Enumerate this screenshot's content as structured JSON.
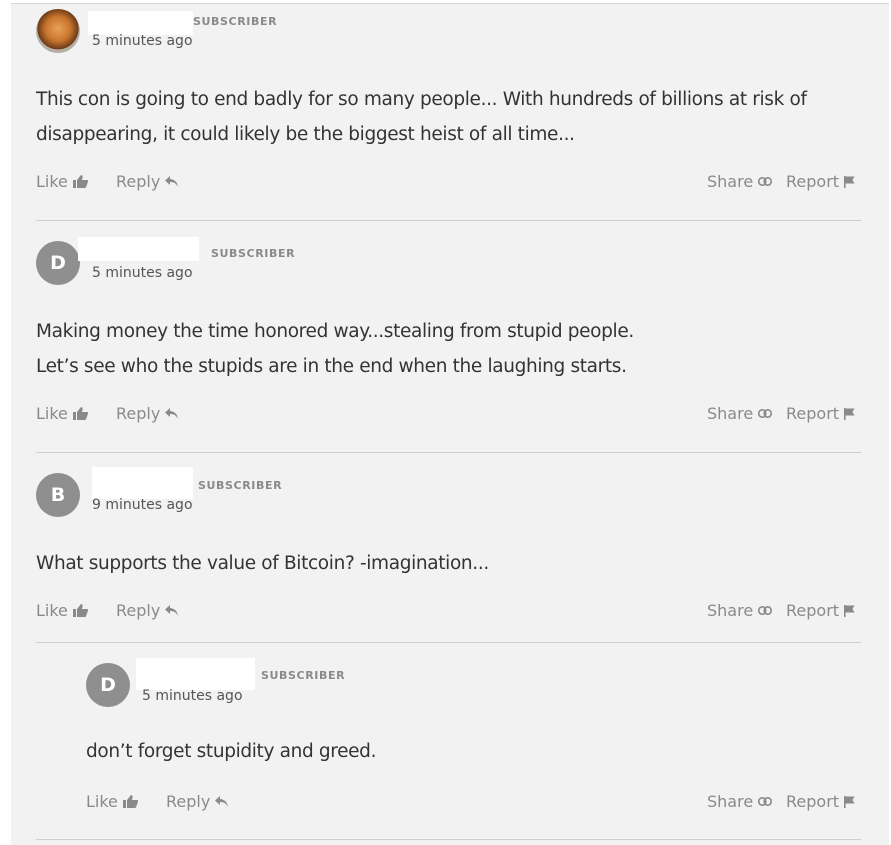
{
  "badge_label": "SUBSCRIBER",
  "actions": {
    "like": "Like",
    "reply": "Reply",
    "share": "Share",
    "report": "Report"
  },
  "comments": [
    {
      "avatar_letter": "",
      "avatar_kind": "tiger photo",
      "time": "5 minutes ago",
      "lines": [
        "This con is going to end badly for so many people... With hundreds of billions at risk of",
        "disappearing, it could likely be the biggest heist of all time..."
      ]
    },
    {
      "avatar_letter": "D",
      "time": "5 minutes ago",
      "lines": [
        "Making money the time honored way...stealing from stupid people.",
        "Let’s see who the stupids are in the end when the laughing starts."
      ]
    },
    {
      "avatar_letter": "B",
      "time": "9 minutes ago",
      "lines": [
        "What supports the value of Bitcoin? -imagination..."
      ]
    },
    {
      "avatar_letter": "D",
      "time": "5 minutes ago",
      "is_reply": true,
      "lines": [
        "don’t forget stupidity and greed."
      ]
    }
  ]
}
